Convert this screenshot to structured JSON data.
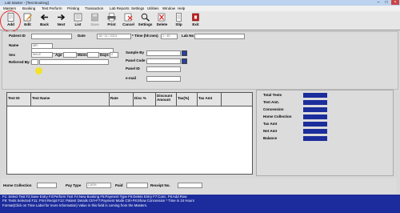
{
  "window": {
    "title": "Lab Master - [Test Booking]",
    "min": "–",
    "max": "□",
    "close": "×"
  },
  "menu": [
    "Masters",
    "Booking",
    "Test Perform",
    "Printing",
    "Transaction",
    "Lab Reports",
    "Settings",
    "Utilities",
    "Window",
    "Help"
  ],
  "toolbar": [
    {
      "label": "Add",
      "icon": "add-page-icon",
      "enabled": true
    },
    {
      "label": "Edit",
      "icon": "edit-icon",
      "enabled": true
    },
    {
      "label": "Back",
      "icon": "back-arrow-icon",
      "enabled": true
    },
    {
      "label": "Next",
      "icon": "next-arrow-icon",
      "enabled": true
    },
    {
      "label": "List",
      "icon": "list-icon",
      "enabled": true
    },
    {
      "label": "Save",
      "icon": "save-icon",
      "enabled": false
    },
    {
      "label": "Print",
      "icon": "printer-icon",
      "enabled": true
    },
    {
      "label": "Cancel",
      "icon": "cancel-icon",
      "enabled": true
    },
    {
      "label": "Settings",
      "icon": "settings-icon",
      "enabled": true
    },
    {
      "label": "Delete",
      "icon": "delete-icon",
      "enabled": true
    },
    {
      "label": "Slip",
      "icon": "slip-icon",
      "enabled": true
    },
    {
      "label": "Exit",
      "icon": "exit-icon",
      "enabled": true
    }
  ],
  "form": {
    "patient_id_label": "Patient ID",
    "date_label": "Date",
    "date_value": "18 / 11 / 2013",
    "time_label": "* Time (hh:mm)",
    "time_value": "1 : 45",
    "lab_no_label": "Lab No",
    "name_label": "Name",
    "title_value": "MR.",
    "sex_label": "Sex",
    "sex_value": "MALE",
    "age_label": "Age",
    "mons_label": "Mons",
    "days_label": "Days",
    "days_value": "0",
    "referred_label": "Referred By:",
    "sample_by_label": "Sample By",
    "panel_code_label": "Panel Code",
    "panel_id_label": "Panel ID",
    "email_label": "e-mail"
  },
  "grid": {
    "columns": [
      "Test ID",
      "Test Name",
      "Rate",
      "Disc %",
      "Discount Amount",
      "Tax(%)",
      "Tax Amt"
    ]
  },
  "summary": {
    "rows": [
      "Total Tests",
      "Test Amt.",
      "Concession",
      "Home Collection",
      "Tax Amt",
      "Net Amt",
      "Balance"
    ]
  },
  "bottom": {
    "home_collection_label": "Home Collection",
    "pay_type_label": "Pay Type",
    "pay_type_value": "CASH",
    "paid_label": "Paid",
    "receipt_label": "Receipt No."
  },
  "hints": [
    "F1: Select Test F2:Save Entry F3:Perform Test F4:New Booking F5:Payment Type F6:Delete Entry F7:Conc. F8:Add  Row",
    "F9: Tests Selected F11: Print Recipt  F12: Patient Details   Ctrl+F7:Payment Mode   Ctrl+F8:Show Concession  * Time in 24 Hours",
    "Format(Click on Time Label for more Information)  Value in this field is coming from the Masters."
  ],
  "colors": {
    "accent": "#1c2d9c",
    "titlebar": "#bcd2ee",
    "highlight_circle": "#d33333",
    "pointer": "#f3e21a"
  }
}
